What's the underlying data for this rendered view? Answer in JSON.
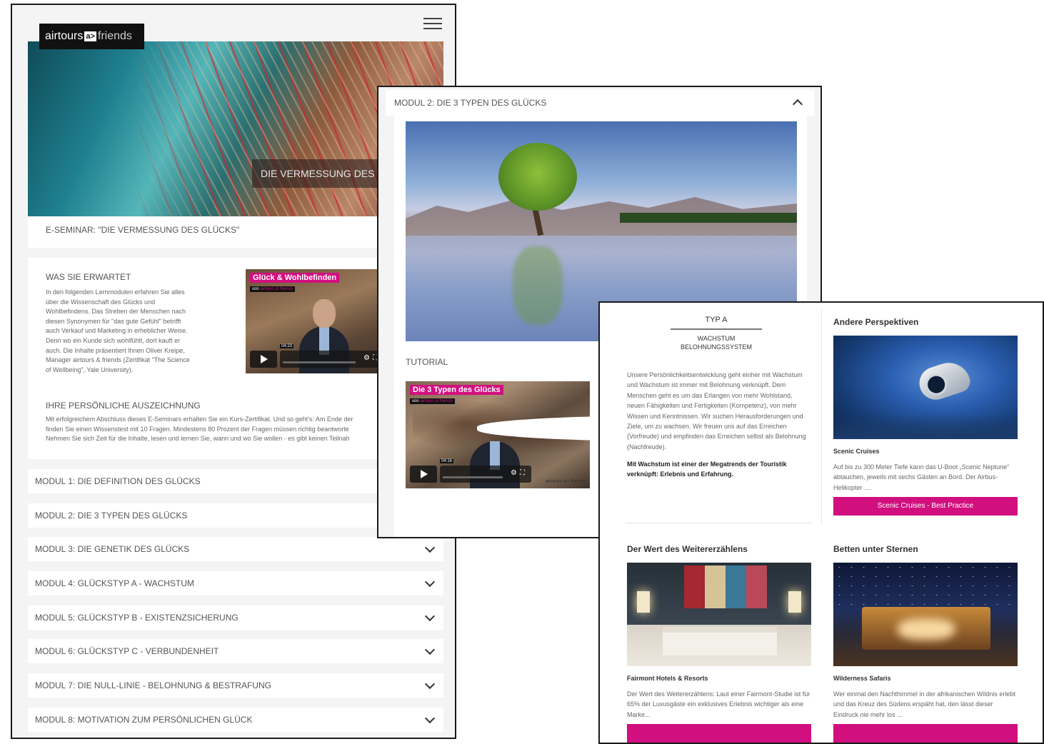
{
  "panel1": {
    "logo": {
      "left": "airtours",
      "mark": "a>",
      "right": "friends"
    },
    "hero_caption": "DIE VERMESSUNG DES G",
    "subtitle": "E-SEMINAR: \"DIE VERMESSUNG DES GLÜCKS\"",
    "expect_title": "WAS SIE ERWARTET",
    "expect_lines": [
      "In den folgenden Lernmodulen erfahren Sie alles",
      "über die Wissenschaft des Glücks und",
      "Wohlbefindens. Das Streben der Menschen nach",
      "diesen Synonymen für \"das gute Gefühl\" betrifft",
      "auch Verkauf und Marketing in erheblicher Weise.",
      "Denn wo ein Kunde sich wohlfühlt, dort kauft er",
      "auch. Die Inhalte präsentiert Ihnen Oliver Kreipe,",
      "Manager airtours & friends (Zertifikat \"The Science",
      "of Wellbeing\", Yale University)."
    ],
    "video": {
      "title": "Glück & Wohlbefinden",
      "by": "von",
      "brand": "airtours & friends",
      "time": "04:23"
    },
    "award_title": "IHRE PERSÖNLICHE AUSZEICHNUNG",
    "award_lines": [
      "Mit erfolgreichem Abschluss dieses E-Seminars erhalten Sie ein Kurs-Zertifikat. Und so geht's: Am Ende der",
      "finden Sie einen Wissenstest mit 10 Fragen. Mindestens 80 Prozent der Fragen müssen richtig beantworte",
      "Nehmen Sie sich Zeit für die Inhalte, lesen und lernen Sie, wann und wo Sie wollen - es gibt keinen Teilnah"
    ],
    "modules": [
      "MODUL 1: DIE DEFINITION DES GLÜCKS",
      "MODUL 2: DIE 3 TYPEN DES GLÜCKS",
      "MODUL 3: DIE GENETIK DES GLÜCKS",
      "MODUL 4: GLÜCKSTYP A - WACHSTUM",
      "MODUL 5: GLÜCKSTYP B - EXISTENZSICHERUNG",
      "MODUL 6: GLÜCKSTYP C - VERBUNDENHEIT",
      "MODUL 7: DIE NULL-LINIE - BELOHNUNG & BESTRAFUNG",
      "MODUL 8: MOTIVATION ZUM PERSÖNLICHEN GLÜCK"
    ]
  },
  "panel2": {
    "header": "MODUL 2: DIE 3 TYPEN DES GLÜCKS",
    "tutorial": "TUTORIAL",
    "video": {
      "title": "Die 3 Typen des Glücks",
      "by": "von",
      "brand": "airtours & friends",
      "time": "04:16",
      "footer_brand": "airtours a> friends"
    }
  },
  "panel3": {
    "typ": "TYP A",
    "typ_sub1": "WACHSTUM",
    "typ_sub2": "BELOHNUNGSSYSTEM",
    "typ_text": "Unsere Persönlichkeitsentwicklung geht einher mit Wachstum und Wachstum ist immer mit Belohnung verknüpft. Dem Menschen geht es um das Erlangen von mehr Wohlstand, neuen Fähigkeiten und Fertigkeiten (Kompetenz), von mehr Wissen und Kenntnissen. Wir suchen Herausforderungen und Ziele, um zu wachsen. Wir freuen uns auf das Erreichen (Vorfreude) und empfinden das Erreichen selbst als Belohnung (Nachfreude).",
    "typ_bold": "Mit Wachstum ist einer der Megatrends der Touristik verknüpft: Erlebnis und Erfahrung.",
    "cards": [
      {
        "title": "Andere Perspektiven",
        "label": "Scenic Cruises",
        "desc": "Auf bis zu 300 Meter Tiefe kann das U-Boot „Scenic Neptune“ abtauchen, jeweils mit sechs Gästen an Bord. Der Airbus-Helikopter ....",
        "button": "Scenic Cruises - Best Practice"
      },
      {
        "title": "Der Wert des Weitererzählens",
        "label": "Fairmont Hotels & Resorts",
        "desc": "Der Wert des Weitererzählens: Laut einer Fairmont-Studie ist für 65% der Luxusgäste ein exklusives Erlebnis wichtiger als eine Marke...",
        "button": ""
      },
      {
        "title": "Betten unter Sternen",
        "label": "Wilderness Safaris",
        "desc": "Wer einmal den Nachthimmel in der afrikanischen Wildnis erlebt und das Kreuz des Südens erspäht hat, den lässt dieser Eindruck nie mehr los ...",
        "button": ""
      }
    ]
  }
}
